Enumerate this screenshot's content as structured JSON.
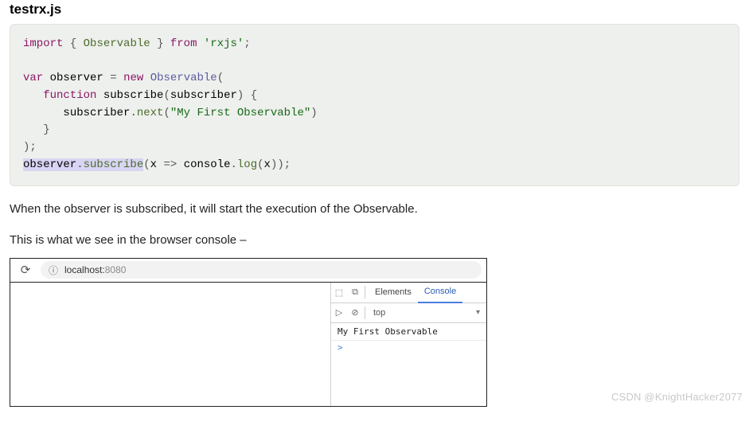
{
  "file": {
    "name": "testrx.js"
  },
  "code": {
    "l1": {
      "import": "import",
      "lb": "{",
      "id": "Observable",
      "rb": "}",
      "from": "from",
      "str": "'rxjs'",
      "semi": ";"
    },
    "l3": {
      "var": "var",
      "name": "observer",
      "eq": "=",
      "new": "new",
      "type": "Observable",
      "lp": "("
    },
    "l4": {
      "func": "function",
      "fname": "subscribe",
      "lp": "(",
      "arg": "subscriber",
      "rp": ")",
      "lb": "{"
    },
    "l5": {
      "obj": "subscriber",
      "dot": ".",
      "meth": "next",
      "lp": "(",
      "str": "\"My First Observable\"",
      "rp": ")"
    },
    "l6": {
      "rb": "}"
    },
    "l7": {
      "rp": ")",
      "semi": ";"
    },
    "l8": {
      "obj": "observer",
      "dot": ".",
      "meth": "subscribe",
      "lp": "(",
      "x": "x",
      "arrow": "=>",
      "cons": "console",
      "dot2": ".",
      "log": "log",
      "lp2": "(",
      "x2": "x",
      "rp2": ")",
      "rp": ")",
      "semi": ";"
    }
  },
  "paras": {
    "p1": "When the observer is subscribed, it will start the execution of the Observable.",
    "p2": "This is what we see in the browser console –"
  },
  "browser": {
    "reload_glyph": "⟳",
    "info_glyph": "ⓘ",
    "host": "localhost:",
    "port": "8080",
    "devtools": {
      "inspect_glyph": "⬚",
      "device_glyph": "⧉",
      "tabs": {
        "elements": "Elements",
        "console": "Console"
      },
      "filter": {
        "play": "▷",
        "clear": "⊘",
        "scope": "top",
        "dropdown": "▾"
      },
      "output": "My First Observable",
      "prompt": ">"
    }
  },
  "watermark": "CSDN @KnightHacker2077"
}
